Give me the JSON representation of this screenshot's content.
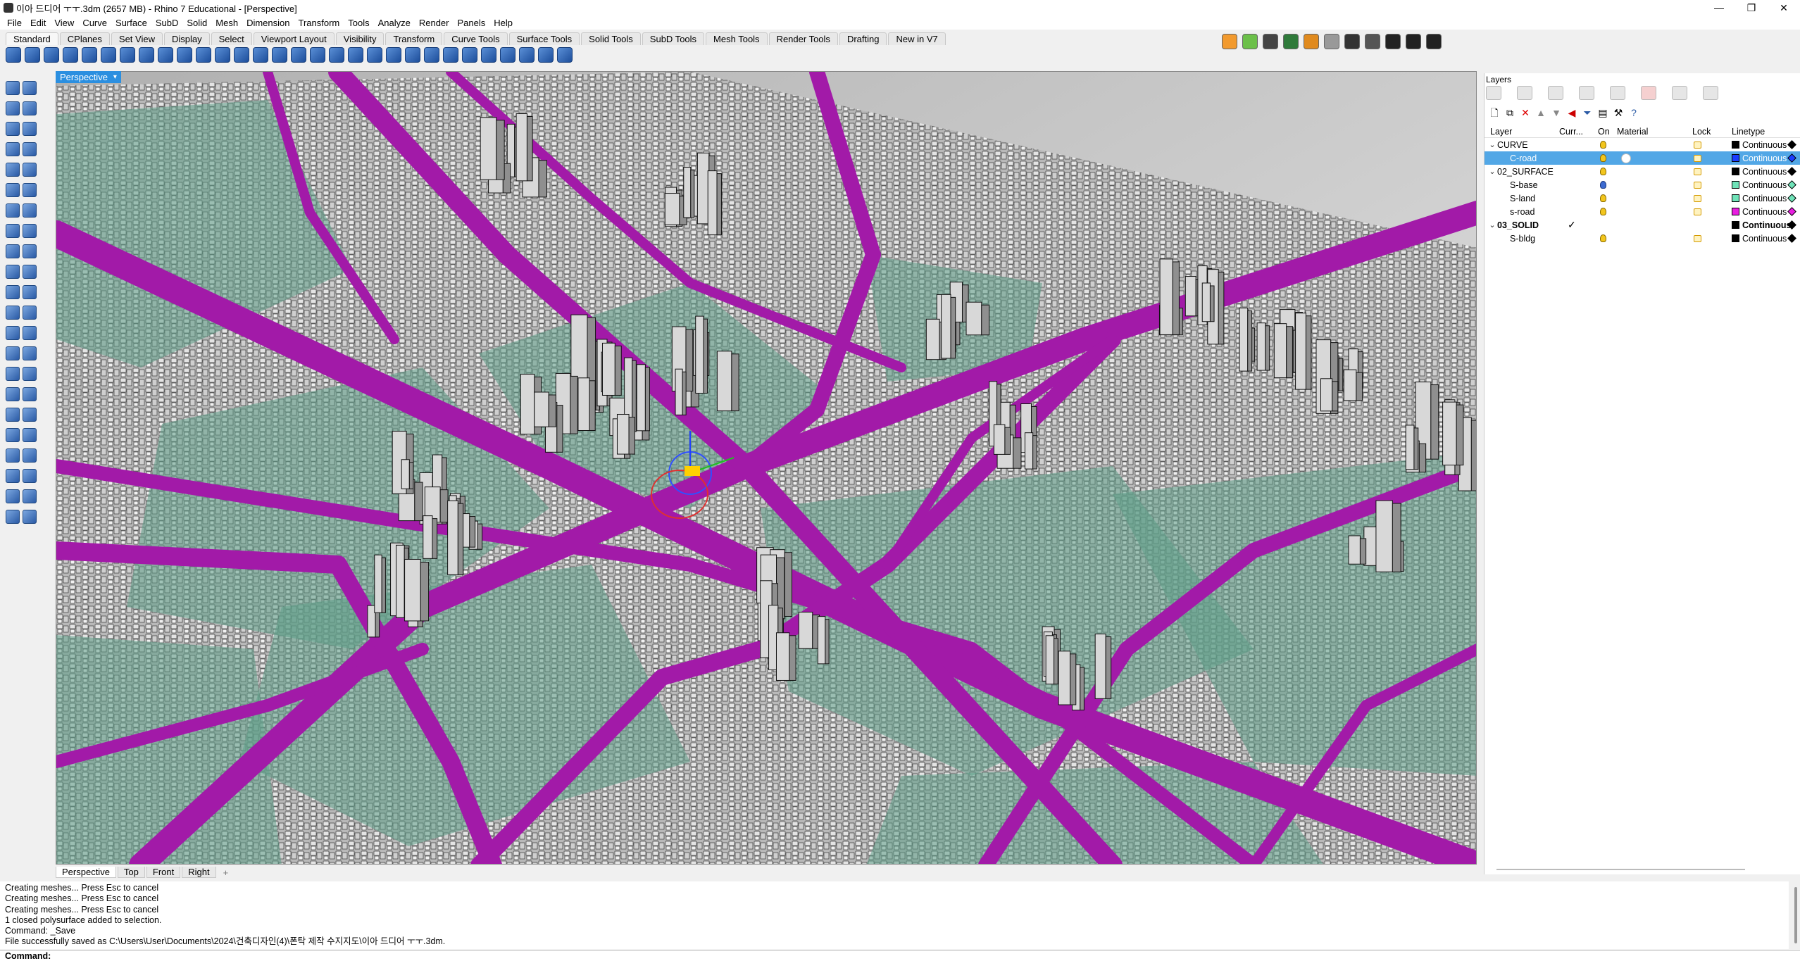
{
  "window": {
    "title": "이아 드디어 ㅜㅜ.3dm (2657 MB) - Rhino 7 Educational - [Perspective]",
    "controls": [
      "—",
      "❐",
      "✕"
    ]
  },
  "menu": [
    "File",
    "Edit",
    "View",
    "Curve",
    "Surface",
    "SubD",
    "Solid",
    "Mesh",
    "Dimension",
    "Transform",
    "Tools",
    "Analyze",
    "Render",
    "Panels",
    "Help"
  ],
  "toolbar_tabs": [
    "Standard",
    "CPlanes",
    "Set View",
    "Display",
    "Select",
    "Viewport Layout",
    "Visibility",
    "Transform",
    "Curve Tools",
    "Surface Tools",
    "Solid Tools",
    "SubD Tools",
    "Mesh Tools",
    "Render Tools",
    "Drafting",
    "New in V7"
  ],
  "viewport": {
    "name": "Perspective",
    "tabs": [
      "Perspective",
      "Top",
      "Front",
      "Right"
    ],
    "add_tab": "+",
    "colors": {
      "road": "#a21aa8",
      "surface": "#5f9f88",
      "building": "#d8d8d8"
    }
  },
  "layers_panel": {
    "title": "Layers",
    "columns": {
      "layer": "Layer",
      "current": "Curr...",
      "on": "On",
      "material": "Material",
      "lock": "Lock",
      "linetype": "Linetype"
    },
    "layers": [
      {
        "name": "CURVE",
        "group": true,
        "expanded": true,
        "current": false,
        "on_icon": "yellow",
        "lock": true,
        "color": "#000000",
        "linetype": "Continuous",
        "selected": false
      },
      {
        "name": "C-road",
        "group": false,
        "current": false,
        "on_icon": "yellow",
        "lock": true,
        "color": "#1a3cff",
        "linetype": "Continuous",
        "selected": true
      },
      {
        "name": "02_SURFACE",
        "group": true,
        "expanded": true,
        "current": false,
        "on_icon": "yellow",
        "lock": true,
        "color": "#000000",
        "linetype": "Continuous",
        "selected": false
      },
      {
        "name": "S-base",
        "group": false,
        "current": false,
        "on_icon": "blue",
        "lock": true,
        "color": "#6fe3b8",
        "linetype": "Continuous",
        "selected": false
      },
      {
        "name": "S-land",
        "group": false,
        "current": false,
        "on_icon": "yellow",
        "lock": true,
        "color": "#6fe3b8",
        "linetype": "Continuous",
        "selected": false
      },
      {
        "name": "s-road",
        "group": false,
        "current": false,
        "on_icon": "yellow",
        "lock": true,
        "color": "#e81ee0",
        "linetype": "Continuous",
        "selected": false
      },
      {
        "name": "03_SOLID",
        "group": true,
        "expanded": true,
        "current": true,
        "on_icon": "none",
        "lock": false,
        "color": "#000000",
        "linetype": "Continuous",
        "selected": false
      },
      {
        "name": "S-bldg",
        "group": false,
        "current": false,
        "on_icon": "yellow",
        "lock": true,
        "color": "#000000",
        "linetype": "Continuous",
        "selected": false
      }
    ]
  },
  "command_history": [
    "Creating meshes... Press Esc to cancel",
    "Creating meshes... Press Esc to cancel",
    "Creating meshes... Press Esc to cancel",
    "1 closed polysurface added to selection.",
    "Command: _Save",
    "File successfully saved as C:\\Users\\User\\Documents\\2024\\건축디자인(4)\\폰탁 제작 수지지도\\이아 드디어 ㅜㅜ.3dm."
  ],
  "command_prompt": "Command:"
}
